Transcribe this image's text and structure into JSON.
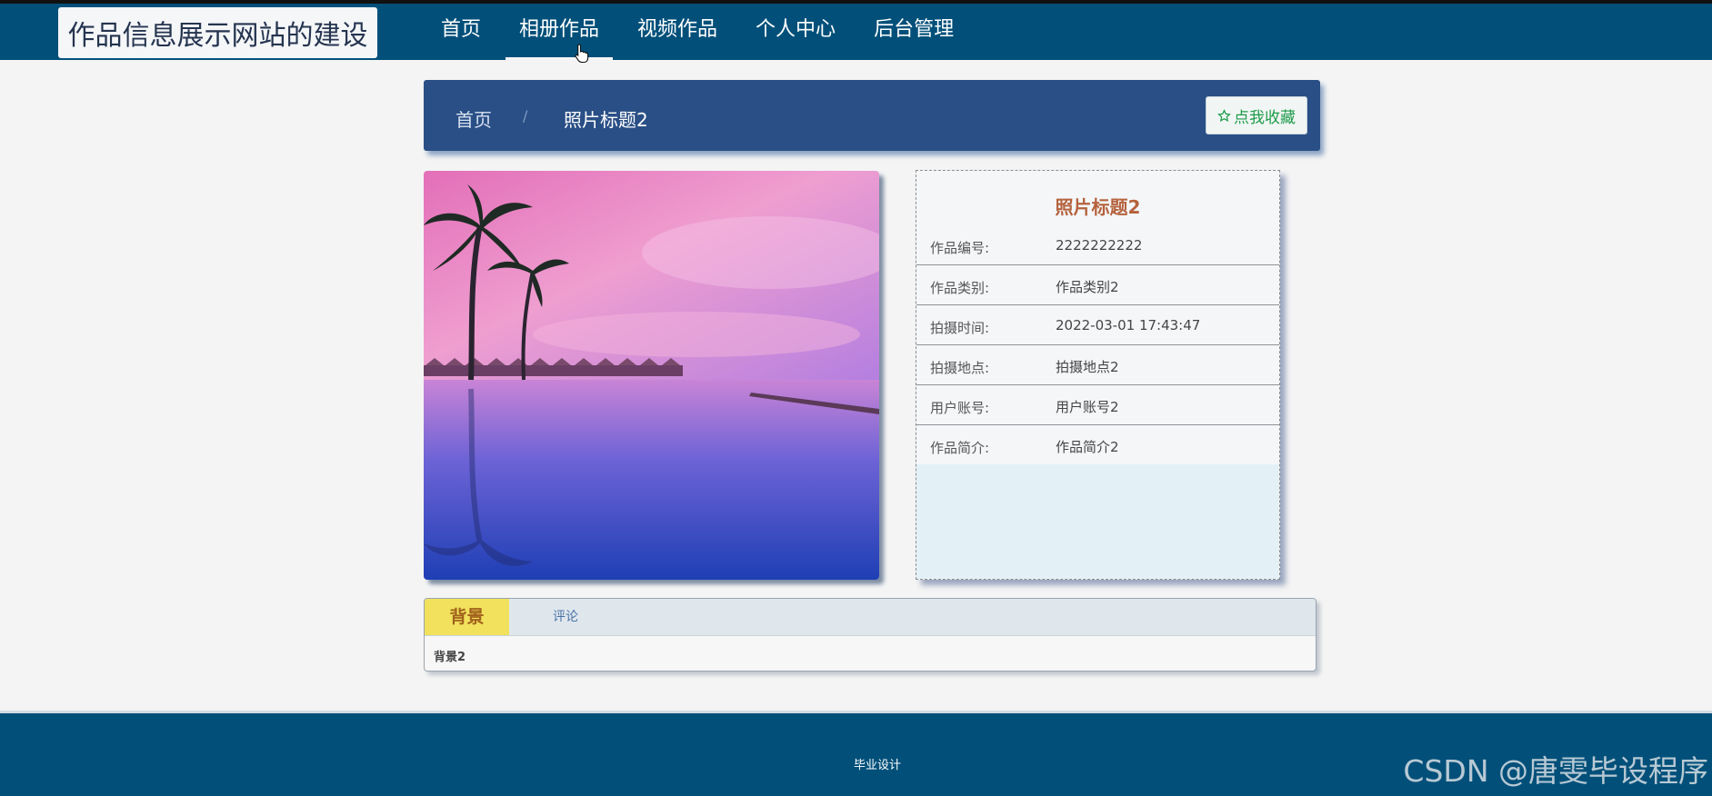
{
  "header": {
    "site_title": "作品信息展示网站的建设",
    "nav": [
      {
        "label": "首页"
      },
      {
        "label": "相册作品"
      },
      {
        "label": "视频作品"
      },
      {
        "label": "个人中心"
      },
      {
        "label": "后台管理"
      }
    ],
    "active_nav": "相册作品"
  },
  "breadcrumb": {
    "home": "首页",
    "separator": "/",
    "current": "照片标题2",
    "favorite_button": "点我收藏",
    "favorite_icon": "star-outline-icon"
  },
  "detail": {
    "title": "照片标题2",
    "fields": [
      {
        "label": "作品编号:",
        "value": "2222222222"
      },
      {
        "label": "作品类别:",
        "value": "作品类别2"
      },
      {
        "label": "拍摄时间:",
        "value": "2022-03-01 17:43:47"
      },
      {
        "label": "拍摄地点:",
        "value": "拍摄地点2"
      },
      {
        "label": "用户账号:",
        "value": "用户账号2"
      },
      {
        "label": "作品简介:",
        "value": "作品简介2"
      }
    ]
  },
  "tabs": {
    "items": [
      {
        "label": "背景"
      },
      {
        "label": "评论"
      }
    ],
    "active": "背景",
    "content": "背景2"
  },
  "footer": {
    "text": "毕业设计",
    "watermark": "CSDN @唐雯毕设程序"
  },
  "colors": {
    "header_bg": "#02507a",
    "breadcrumb_bg": "#2a4f86",
    "title_accent": "#b5623d",
    "favorite_green": "#1e9b4a",
    "active_tab": "#f1e15d"
  }
}
